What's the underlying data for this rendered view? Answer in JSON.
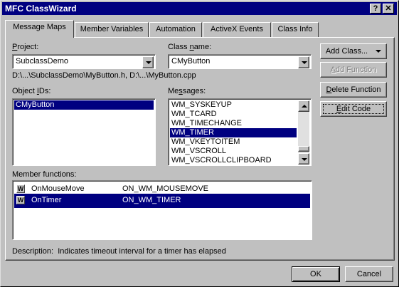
{
  "window": {
    "title": "MFC ClassWizard",
    "help_glyph": "?",
    "close_glyph": "✕"
  },
  "tabs": [
    "Message Maps",
    "Member Variables",
    "Automation",
    "ActiveX Events",
    "Class Info"
  ],
  "project": {
    "label_u": "P",
    "label_rest": "roject:",
    "value": "SubclassDemo"
  },
  "class_name": {
    "label_pre": "Class ",
    "label_u": "n",
    "label_rest": "ame:",
    "value": "CMyButton"
  },
  "paths": "D:\\...\\SubclassDemo\\MyButton.h, D:\\...\\MyButton.cpp",
  "object_ids": {
    "label_pre": "Object ",
    "label_u": "I",
    "label_rest": "Ds:",
    "items": [
      "CMyButton"
    ]
  },
  "messages": {
    "label_pre": "Me",
    "label_u": "s",
    "label_rest": "sages:",
    "items": [
      "WM_SYSKEYUP",
      "WM_TCARD",
      "WM_TIMECHANGE",
      "WM_TIMER",
      "WM_VKEYTOITEM",
      "WM_VSCROLL",
      "WM_VSCROLLCLIPBOARD"
    ],
    "selected": "WM_TIMER"
  },
  "buttons": {
    "add_class": "Add Class...",
    "add_function_u": "A",
    "add_function_rest": "dd Function",
    "delete_function_u": "D",
    "delete_function_rest": "elete Function",
    "edit_code_u": "E",
    "edit_code_rest": "dit Code",
    "ok": "OK",
    "cancel": "Cancel"
  },
  "member_functions": {
    "label": "Member functions:",
    "rows": [
      {
        "icon": "W",
        "name": "OnMouseMove",
        "handler": "ON_WM_MOUSEMOVE",
        "selected": false
      },
      {
        "icon": "W",
        "name": "OnTimer",
        "handler": "ON_WM_TIMER",
        "selected": true
      }
    ]
  },
  "description": {
    "label": "Description:",
    "text": "Indicates timeout interval for a timer has elapsed"
  }
}
